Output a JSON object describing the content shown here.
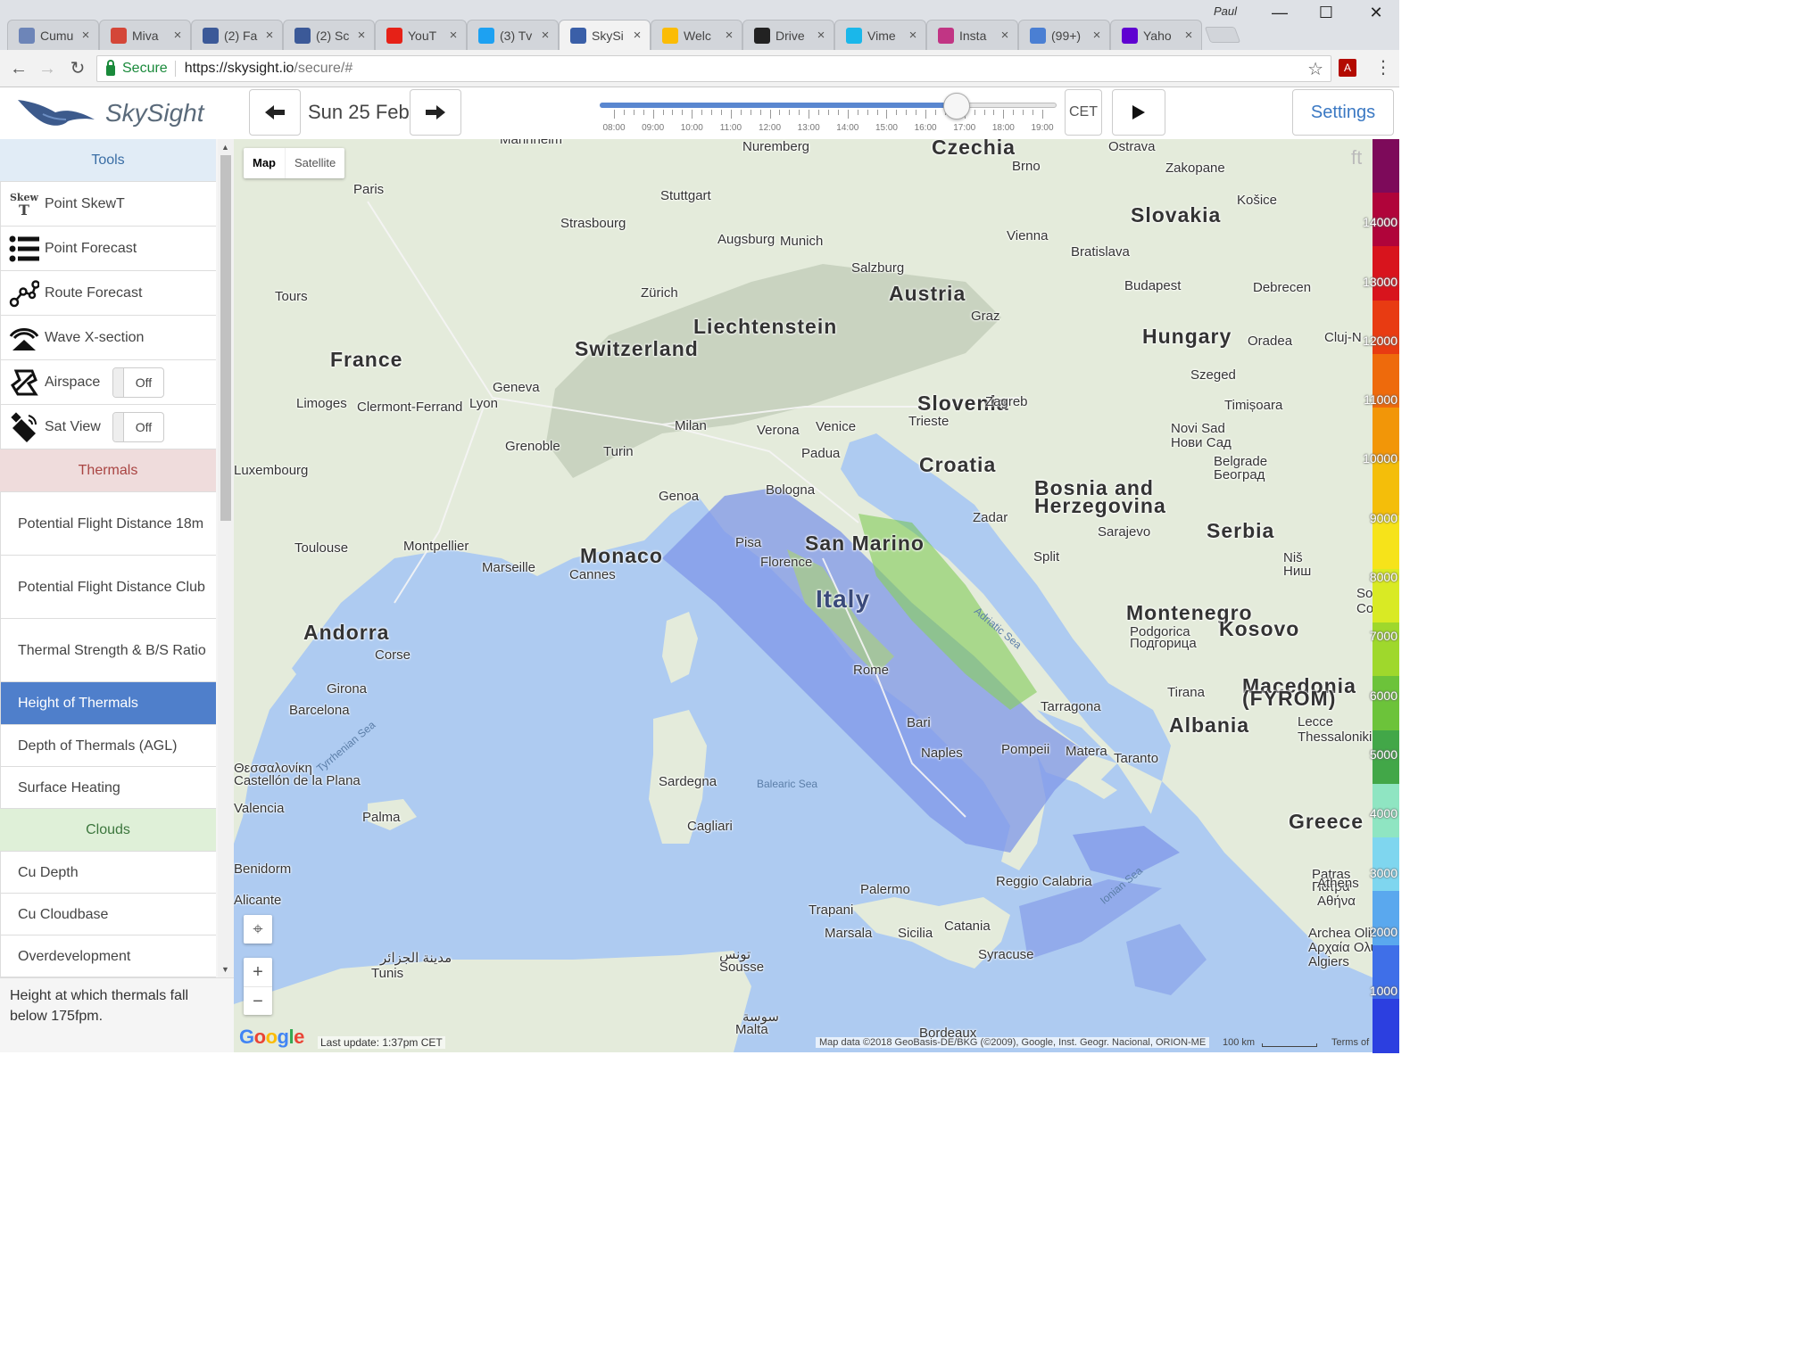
{
  "browser": {
    "profile_name": "Paul",
    "tabs": [
      {
        "title": "Cumu",
        "icon": "cumulus-icon",
        "color": "#6d85b8"
      },
      {
        "title": "Miva",
        "icon": "gmail-icon",
        "color": "#d44638"
      },
      {
        "title": "(2) Fa",
        "icon": "facebook-icon",
        "color": "#3b5998"
      },
      {
        "title": "(2) Sc",
        "icon": "facebook-icon",
        "color": "#3b5998"
      },
      {
        "title": "YouT",
        "icon": "youtube-icon",
        "color": "#e62117"
      },
      {
        "title": "(3) Tv",
        "icon": "twitter-icon",
        "color": "#1da1f2"
      },
      {
        "title": "SkySi",
        "icon": "skysight-icon",
        "color": "#3a5fa8",
        "active": true
      },
      {
        "title": "Welc",
        "icon": "google-photos-icon",
        "color": "#fbbc05"
      },
      {
        "title": "Drive",
        "icon": "drive-icon",
        "color": "#222222"
      },
      {
        "title": "Vime",
        "icon": "vimeo-icon",
        "color": "#1ab7ea"
      },
      {
        "title": "Insta",
        "icon": "instagram-icon",
        "color": "#c13584"
      },
      {
        "title": "(99+)",
        "icon": "messages-icon",
        "color": "#4a7fd3"
      },
      {
        "title": "Yaho",
        "icon": "yahoo-icon",
        "color": "#5f01d1"
      }
    ],
    "tab_close": "×",
    "nav": {
      "back": "←",
      "forward": "→",
      "reload": "↻"
    },
    "address": {
      "secure_label": "Secure",
      "url_host": "https://skysight.io",
      "url_path": "/secure/#"
    },
    "window": {
      "minimize": "—",
      "maximize": "☐",
      "close": "✕"
    },
    "star": "☆",
    "pdf": "A",
    "menu": "⋮"
  },
  "header": {
    "app_title": "SkySight",
    "date": "Sun 25 Feb",
    "prev_arrow": "🡐",
    "next_arrow": "🡒",
    "timezone": "CET",
    "settings": "Settings",
    "time_labels": [
      "08:00",
      "09:00",
      "10:00",
      "11:00",
      "12:00",
      "13:00",
      "14:00",
      "15:00",
      "16:00",
      "17:00",
      "18:00",
      "19:00"
    ],
    "time_position_fraction": 0.8
  },
  "sidebar": {
    "tools_heading": "Tools",
    "tools": [
      {
        "label": "Point SkewT",
        "icon": "skewt-icon"
      },
      {
        "label": "Point Forecast",
        "icon": "list-icon"
      },
      {
        "label": "Route Forecast",
        "icon": "route-icon"
      },
      {
        "label": "Wave X-section",
        "icon": "wave-icon"
      },
      {
        "label": "Airspace",
        "icon": "airspace-icon",
        "toggle": "Off"
      },
      {
        "label": "Sat View",
        "icon": "satellite-icon",
        "toggle": "Off"
      }
    ],
    "skewt_icon_text": "Skew",
    "skewt_icon_letter": "T",
    "thermals_heading": "Thermals",
    "thermals": [
      {
        "label": "Potential Flight Distance 18m"
      },
      {
        "label": "Potential Flight Distance Club"
      },
      {
        "label": "Thermal Strength & B/S Ratio"
      },
      {
        "label": "Height of Thermals",
        "active": true
      },
      {
        "label": "Depth of Thermals (AGL)"
      },
      {
        "label": "Surface Heating"
      }
    ],
    "clouds_heading": "Clouds",
    "clouds": [
      {
        "label": "Cu Depth"
      },
      {
        "label": "Cu Cloudbase"
      },
      {
        "label": "Overdevelopment"
      }
    ],
    "description": "Height at which thermals fall below 175fpm.",
    "colors": {
      "tools_bg": "#e1ecf6",
      "tools_fg": "#3a6ea5",
      "thermals_bg": "#efdcdc",
      "thermals_fg": "#a94442",
      "clouds_bg": "#dff0d8",
      "clouds_fg": "#3c763d",
      "active_bg": "#4f7fcb"
    }
  },
  "map": {
    "type_map": "Map",
    "type_satellite": "Satellite",
    "zoom_in": "+",
    "zoom_out": "−",
    "locate_icon": "⌖",
    "google": "Google",
    "last_update": "Last update: 1:37pm CET",
    "attribution": "Map data ©2018 GeoBasis-DE/BKG (©2009), Google, Inst. Geogr. Nacional, ORION-ME",
    "scale": "100 km",
    "terms": "Terms of",
    "unit": "ft",
    "countries": [
      "France",
      "Switzerland",
      "Austria",
      "Liechtenstein",
      "Slovakia",
      "Hungary",
      "Slovenia",
      "Croatia",
      "Bosnia and",
      "Herzegovina",
      "Serbia",
      "Montenegro",
      "Kosovo",
      "Macedonia",
      "(FYROM)",
      "Albania",
      "Greece",
      "Italy",
      "San Marino",
      "Monaco",
      "Andorra",
      "Czechia"
    ],
    "cities": [
      "Paris",
      "Nuremberg",
      "Stuttgart",
      "Strasbourg",
      "Augsburg",
      "Munich",
      "Vienna",
      "Bratislava",
      "Brno",
      "Ostrava",
      "Zakopane",
      "Košice",
      "Salzburg",
      "Zürich",
      "Graz",
      "Budapest",
      "Debrecen",
      "Oradea",
      "Cluj-N",
      "Tours",
      "Limoges",
      "Clermont-Ferrand",
      "Lyon",
      "Geneva",
      "Grenoble",
      "Turin",
      "Milan",
      "Verona",
      "Venice",
      "Padua",
      "Trieste",
      "Zagreb",
      "Szeged",
      "Timișoara",
      "Novi Sad",
      "Нови Сад",
      "Belgrade",
      "Београд",
      "Genoa",
      "Bologna",
      "Pisa",
      "Florence",
      "Zadar",
      "Split",
      "Sarajevo",
      "Toulouse",
      "Montpellier",
      "Marseille",
      "Cannes",
      "Niš",
      "Ниш",
      "Sofia",
      "София",
      "Podgorica",
      "Подгорица",
      "Tirana",
      "Rome",
      "Corse",
      "Girona",
      "Barcelona",
      "Tarragona",
      "Bari",
      "Naples",
      "Pompeii",
      "Matera",
      "Taranto",
      "Lecce",
      "Thessaloniki",
      "Θεσσαλονίκη",
      "Castellón de la Plana",
      "Valencia",
      "Sardegna",
      "Cagliari",
      "Palma",
      "Benidorm",
      "Alicante",
      "Palermo",
      "Trapani",
      "Marsala",
      "Sicilia",
      "Catania",
      "Reggio Calabria",
      "Syracuse",
      "Patras",
      "Πάτρα",
      "Athens",
      "Αθήνα",
      "Archea Olimpia",
      "Αρχαία Ολυμπία",
      "Algiers",
      "مدينة الجزائر",
      "Tunis",
      "تونس",
      "Sousse",
      "سوسة",
      "Malta",
      "Bordeaux",
      "Luxembourg",
      "Mannheim"
    ],
    "seas": [
      "Adriatic Sea",
      "Tyrrhenian Sea",
      "Balearic Sea",
      "Ionian Sea"
    ]
  },
  "colorscale": {
    "labels": [
      "14000",
      "13000",
      "12000",
      "11000",
      "10000",
      "9000",
      "8000",
      "7000",
      "6000",
      "5000",
      "4000",
      "3000",
      "2000",
      "1000"
    ],
    "colors": [
      "#7d0a5a",
      "#b0043a",
      "#d8141d",
      "#e83b12",
      "#ee6a0c",
      "#f29608",
      "#f4be0a",
      "#f6e31a",
      "#d9ea24",
      "#9fd82c",
      "#6cc33a",
      "#42a748",
      "#8fe5c2",
      "#7fd6ef",
      "#5aa8ee",
      "#3f6fe8",
      "#2c3fe0"
    ]
  }
}
